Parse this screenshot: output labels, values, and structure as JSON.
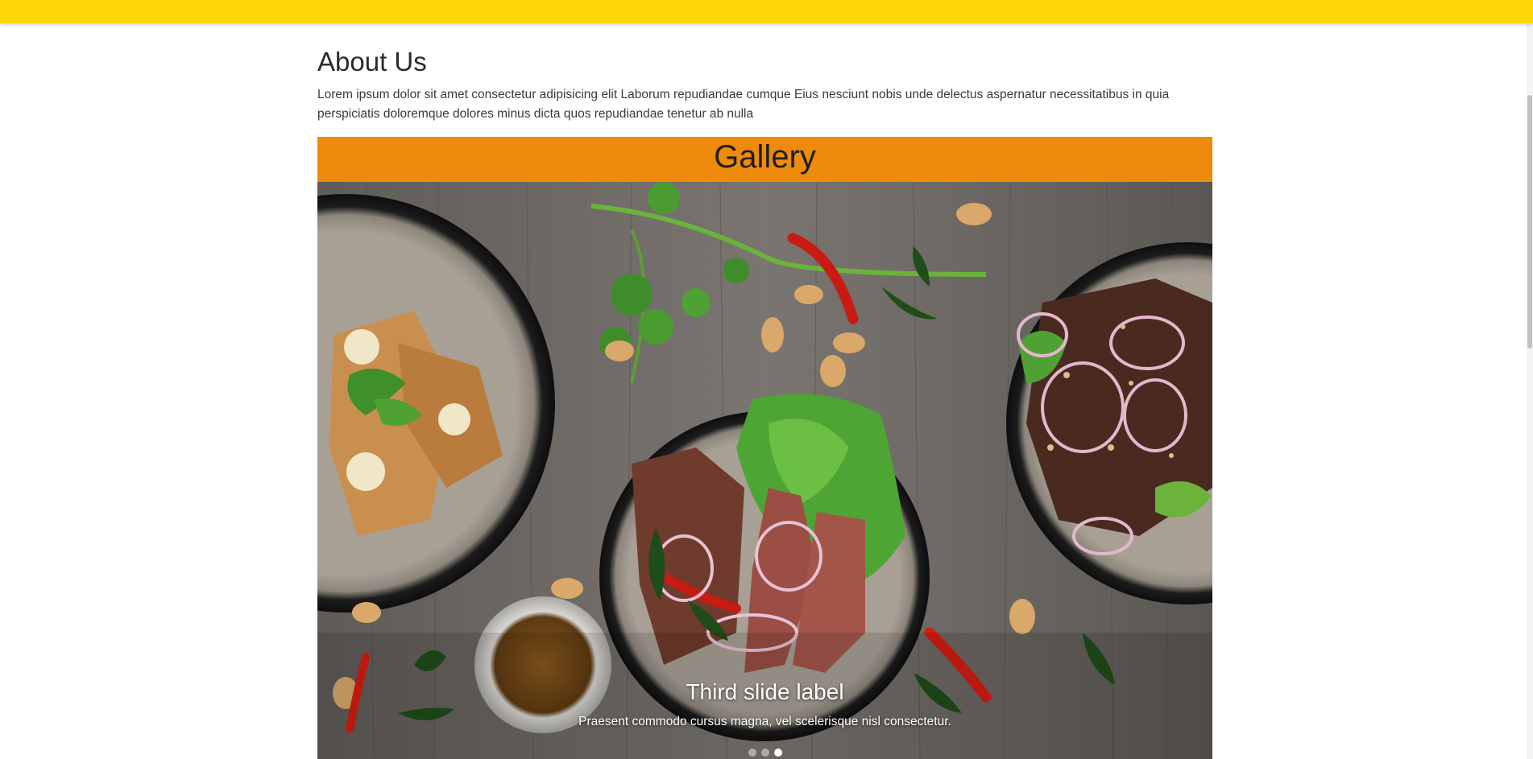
{
  "about": {
    "title": "About Us",
    "text": "Lorem ipsum dolor sit amet consectetur adipisicing elit Laborum repudiandae cumque Eius nesciunt nobis unde delectus aspernatur necessitatibus in quia perspiciatis doloremque dolores minus dicta quos repudiandae tenetur ab nulla"
  },
  "gallery": {
    "title": "Gallery",
    "slide": {
      "label": "Third slide label",
      "text": "Praesent commodo cursus magna, vel scelerisque nisl consectetur."
    },
    "indicators": [
      {
        "active": false
      },
      {
        "active": false
      },
      {
        "active": true
      }
    ]
  },
  "colors": {
    "topbar": "#ffd60a",
    "gallery_header": "#ee8a0c"
  }
}
